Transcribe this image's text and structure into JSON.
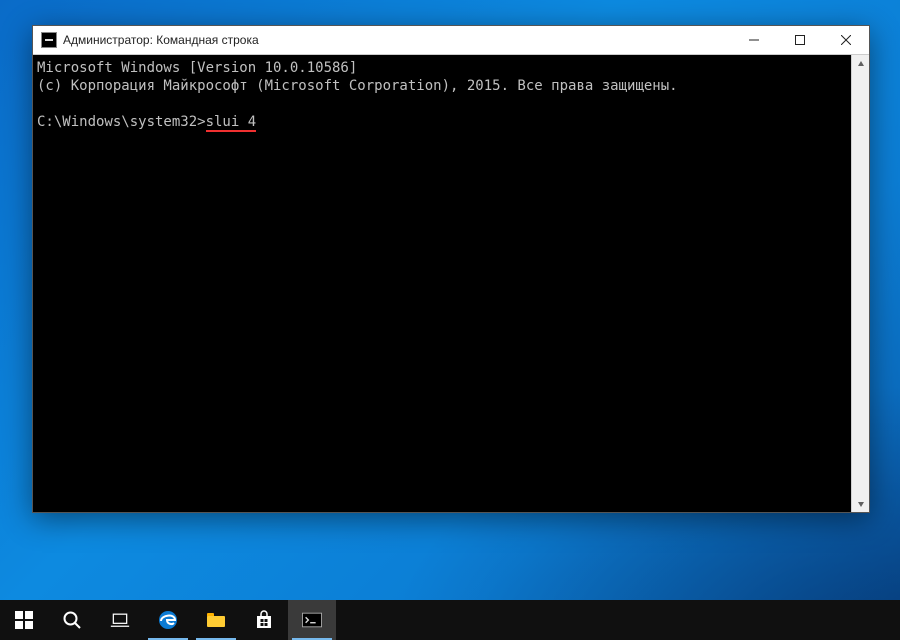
{
  "window": {
    "title": "Администратор: Командная строка"
  },
  "terminal": {
    "line1": "Microsoft Windows [Version 10.0.10586]",
    "line2": "(c) Корпорация Майкрософт (Microsoft Corporation), 2015. Все права защищены.",
    "prompt": "C:\\Windows\\system32>",
    "command": "slui 4"
  },
  "controls": {
    "minimize": "Minimize",
    "maximize": "Maximize",
    "close": "Close"
  },
  "taskbar": {
    "items": [
      {
        "name": "start"
      },
      {
        "name": "search"
      },
      {
        "name": "task-view"
      },
      {
        "name": "edge"
      },
      {
        "name": "file-explorer"
      },
      {
        "name": "store"
      },
      {
        "name": "cmd"
      }
    ]
  }
}
